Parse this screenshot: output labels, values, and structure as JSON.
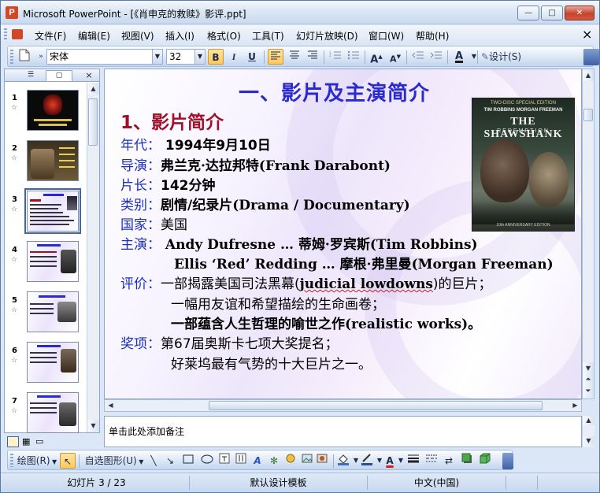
{
  "window": {
    "title": "Microsoft PowerPoint - [《肖申克的救赎》影评.ppt]",
    "minimize_glyph": "—",
    "maximize_glyph": "□",
    "close_glyph": "✕",
    "doc_close_glyph": "×"
  },
  "menu": {
    "items": [
      "文件(F)",
      "编辑(E)",
      "视图(V)",
      "插入(I)",
      "格式(O)",
      "工具(T)",
      "幻灯片放映(D)",
      "窗口(W)",
      "帮助(H)"
    ]
  },
  "toolbar": {
    "font_name": "宋体",
    "font_size": "32",
    "bold_label": "B",
    "italic_label": "I",
    "underline_label": "U",
    "design_label": "设计(S)",
    "icons": [
      "new-icon",
      "bold-icon",
      "italic-icon",
      "underline-icon",
      "align-left-icon",
      "align-center-icon",
      "align-right-icon",
      "numbering-icon",
      "bullets-icon",
      "increase-font-icon",
      "decrease-font-icon",
      "decrease-indent-icon",
      "increase-indent-icon",
      "font-color-icon",
      "design-icon"
    ]
  },
  "left_pane": {
    "tabs": [
      "outline-tab",
      "slides-tab"
    ],
    "slides": [
      {
        "number": "1"
      },
      {
        "number": "2"
      },
      {
        "number": "3"
      },
      {
        "number": "4"
      },
      {
        "number": "5"
      },
      {
        "number": "6"
      },
      {
        "number": "7"
      }
    ],
    "selected_slide": 3,
    "star_glyph": "☆"
  },
  "slide": {
    "title": "一、影片及主演简介",
    "subtitle": "1、影片简介",
    "year_key": "年代：",
    "year_val": " 1994年9月10日",
    "director_key": "导演：",
    "director_val": "弗兰克·达拉邦特(Frank Darabont)",
    "length_key": "片长：",
    "length_val": "142分钟",
    "genre_key": "类别：",
    "genre_val": "剧情/纪录片(Drama / Documentary)",
    "country_key": "国家：",
    "country_val": "美国",
    "cast_key": "主演：",
    "cast_val1": " Andy Dufresne … 蒂姆·罗宾斯(Tim Robbins)",
    "cast_val2": "Ellis ‘Red’ Redding … 摩根·弗里曼(Morgan Freeman)",
    "review_key": "评价：",
    "review_val1_a": "一部揭露美国司法黑幕(",
    "review_val1_b": "judicial lowdowns",
    "review_val1_c": ")的巨片；",
    "review_val2": "一幅用友谊和希望描绘的生命画卷；",
    "review_val3": "一部蕴含人生哲理的喻世之作(realistic works)。",
    "award_key": "奖项：",
    "award_val1": "第67届奥斯卡七项大奖提名；",
    "award_val2": "好莱坞最有气势的十大巨片之一。",
    "poster": {
      "line1": "TWO-DISC SPECIAL EDITION",
      "line2": "TIM ROBBINS     MORGAN FREEMAN",
      "line3": "THE SHAWSHANK",
      "line4": "REDEMPTION",
      "line5": "10th ANNIVERSARY EDITION"
    }
  },
  "notes": {
    "placeholder": "单击此处添加备注"
  },
  "drawing_toolbar": {
    "draw_label": "绘图(R)",
    "autoshapes_label": "自选图形(U)"
  },
  "status": {
    "slide_info": "幻灯片 3 / 23",
    "template": "默认设计模板",
    "language": "中文(中国)"
  },
  "colors": {
    "title_blue": "#2a2ad0",
    "subtitle_red": "#a0102a",
    "key_blue": "#1a2fbf"
  }
}
